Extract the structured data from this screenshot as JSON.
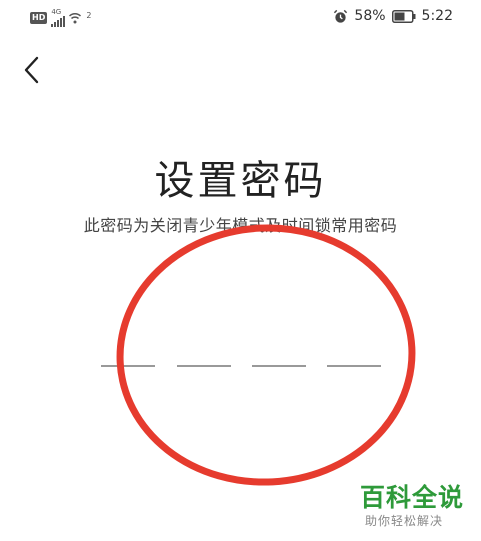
{
  "status_bar": {
    "hd_label": "HD",
    "network_label": "4G",
    "wifi_badge": "2",
    "battery_percent": "58%",
    "time": "5:22",
    "icons": [
      "hd-badge-icon",
      "signal-icon",
      "wifi-icon",
      "alarm-icon",
      "battery-icon"
    ]
  },
  "page": {
    "back_icon": "chevron-left-icon",
    "title": "设置密码",
    "subtitle": "此密码为关闭青少年模式及时间锁常用密码",
    "pin_slot_count": 4
  },
  "annotation": {
    "circle_color": "#e63b2e"
  },
  "watermark": {
    "title": "百科全说",
    "subtitle": "助你轻松解决",
    "color": "#2e9a3a"
  }
}
